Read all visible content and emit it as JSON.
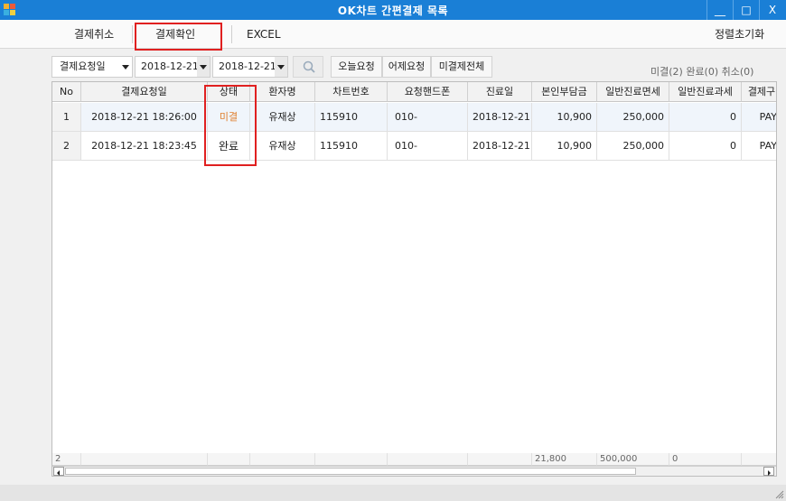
{
  "window": {
    "title": "OK차트 간편결제 목록",
    "minimize_label": "__",
    "maximize_label": "□",
    "close_label": "X"
  },
  "toolbar": {
    "cancel_label": "결제취소",
    "confirm_label": "결제확인",
    "excel_label": "EXCEL",
    "reset_sort_label": "정렬초기화"
  },
  "filter": {
    "date_type": "결제요청일",
    "date_from": "2018-12-21",
    "date_to": "2018-12-21",
    "today_label": "오늘요청",
    "yesterday_label": "어제요청",
    "unpaid_all_label": "미결제전체",
    "counts": "미결(2)  완료(0)  취소(0)"
  },
  "grid": {
    "headers": [
      "No",
      "결제요청일",
      "상태",
      "환자명",
      "차트번호",
      "요청핸드폰",
      "진료일",
      "본인부담금",
      "일반진료면세",
      "일반진료과세",
      "결제구"
    ],
    "rows": [
      {
        "no": "1",
        "req_date": "2018-12-21 18:26:00",
        "status": "미결",
        "patient": "유재상",
        "chart_no": "115910",
        "phone": "010-",
        "visit_date": "2018-12-21",
        "copay": "10,900",
        "exempt": "250,000",
        "taxable": "0",
        "pay_type": "PAY"
      },
      {
        "no": "2",
        "req_date": "2018-12-21 18:23:45",
        "status": "완료",
        "patient": "유재상",
        "chart_no": "115910",
        "phone": "010-",
        "visit_date": "2018-12-21",
        "copay": "10,900",
        "exempt": "250,000",
        "taxable": "0",
        "pay_type": "PAY"
      }
    ],
    "footer": {
      "count": "2",
      "copay_total": "21,800",
      "exempt_total": "500,000",
      "taxable_total": "0"
    }
  },
  "colors": {
    "titlebar": "#1a7fd6",
    "status_pending": "#e08030",
    "highlight_box": "#e02020"
  },
  "icons": {
    "app": "app-grid-icon",
    "search": "magnifier-icon",
    "resize": "resize-grip-icon"
  }
}
